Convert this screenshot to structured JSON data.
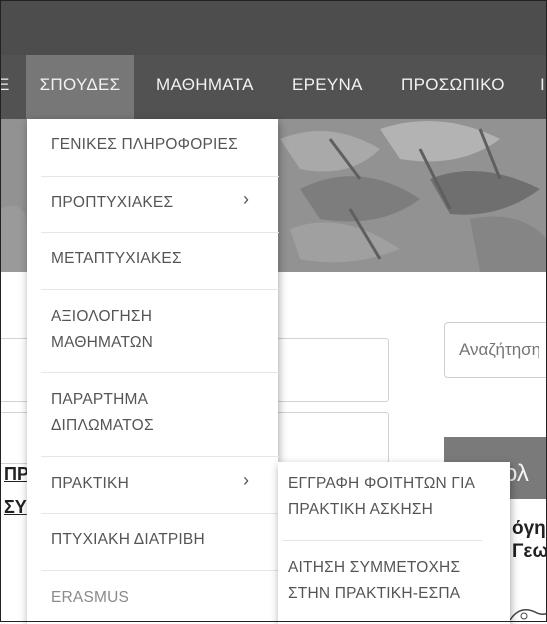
{
  "nav": {
    "items": [
      {
        "label": "ΣΠΟΥΔΕΣ",
        "active": true
      },
      {
        "label": "ΜΑΘΗΜΑΤΑ"
      },
      {
        "label": "ΕΡΕΥΝΑ"
      },
      {
        "label": "ΠΡΟΣΩΠΙΚΟ"
      }
    ],
    "left_fragment": "Ε",
    "right_fragment": "Ι"
  },
  "dropdown": {
    "items": [
      {
        "label_lines": [
          "ΓΕΝΙΚΕΣ ΠΛΗΡΟΦΟΡΙΕΣ"
        ]
      },
      {
        "label_lines": [
          "ΠΡΟΠΤΥΧΙΑΚΕΣ"
        ],
        "has_submenu": true
      },
      {
        "label_lines": [
          "ΜΕΤΑΠΤΥΧΙΑΚΕΣ"
        ]
      },
      {
        "label_lines": [
          "ΑΞΙΟΛΟΓΗΣΗ",
          "ΜΑΘΗΜΑΤΩΝ"
        ]
      },
      {
        "label_lines": [
          "ΠΑΡΑΡΤΗΜΑ",
          "ΔΙΠΛΩΜΑΤΟΣ"
        ]
      },
      {
        "label_lines": [
          "ΠΡΑΚΤΙΚΗ"
        ],
        "has_submenu": true
      },
      {
        "label_lines": [
          "ΠΤΥΧΙΑΚΗ ΔΙΑΤΡΙΒΗ"
        ]
      },
      {
        "label_lines": [
          "ERASMUS"
        ],
        "muted": true
      }
    ],
    "chevron": "›"
  },
  "submenu": {
    "items": [
      {
        "label_lines": [
          "ΕΓΓΡΑΦΗ ΦΟΙΤΗΤΩΝ ΓΙΑ",
          "ΠΡΑΚΤΙΚΗ ΑΣΚΗΣΗ"
        ]
      },
      {
        "label_lines": [
          "ΑΙΤΗΣΗ ΣΥΜΜΕΤΟΧΗΣ",
          "ΣΤΗΝ ΠΡΑΚΤΙΚΗ-ΕΣΠΑ"
        ]
      }
    ]
  },
  "search": {
    "placeholder": "Αναζήτηση"
  },
  "sidebar": {
    "block_fragment": "ολ",
    "text_fragment_1": "όγησ",
    "text_fragment_2": "Γεω"
  },
  "left_links": {
    "line1": "ΠΡ",
    "line2": "ΣΥ"
  },
  "colors": {
    "topbar": "#4d4d4d",
    "navbar": "#525252",
    "nav_active": "#777777",
    "banner": "#8f8f8f"
  }
}
